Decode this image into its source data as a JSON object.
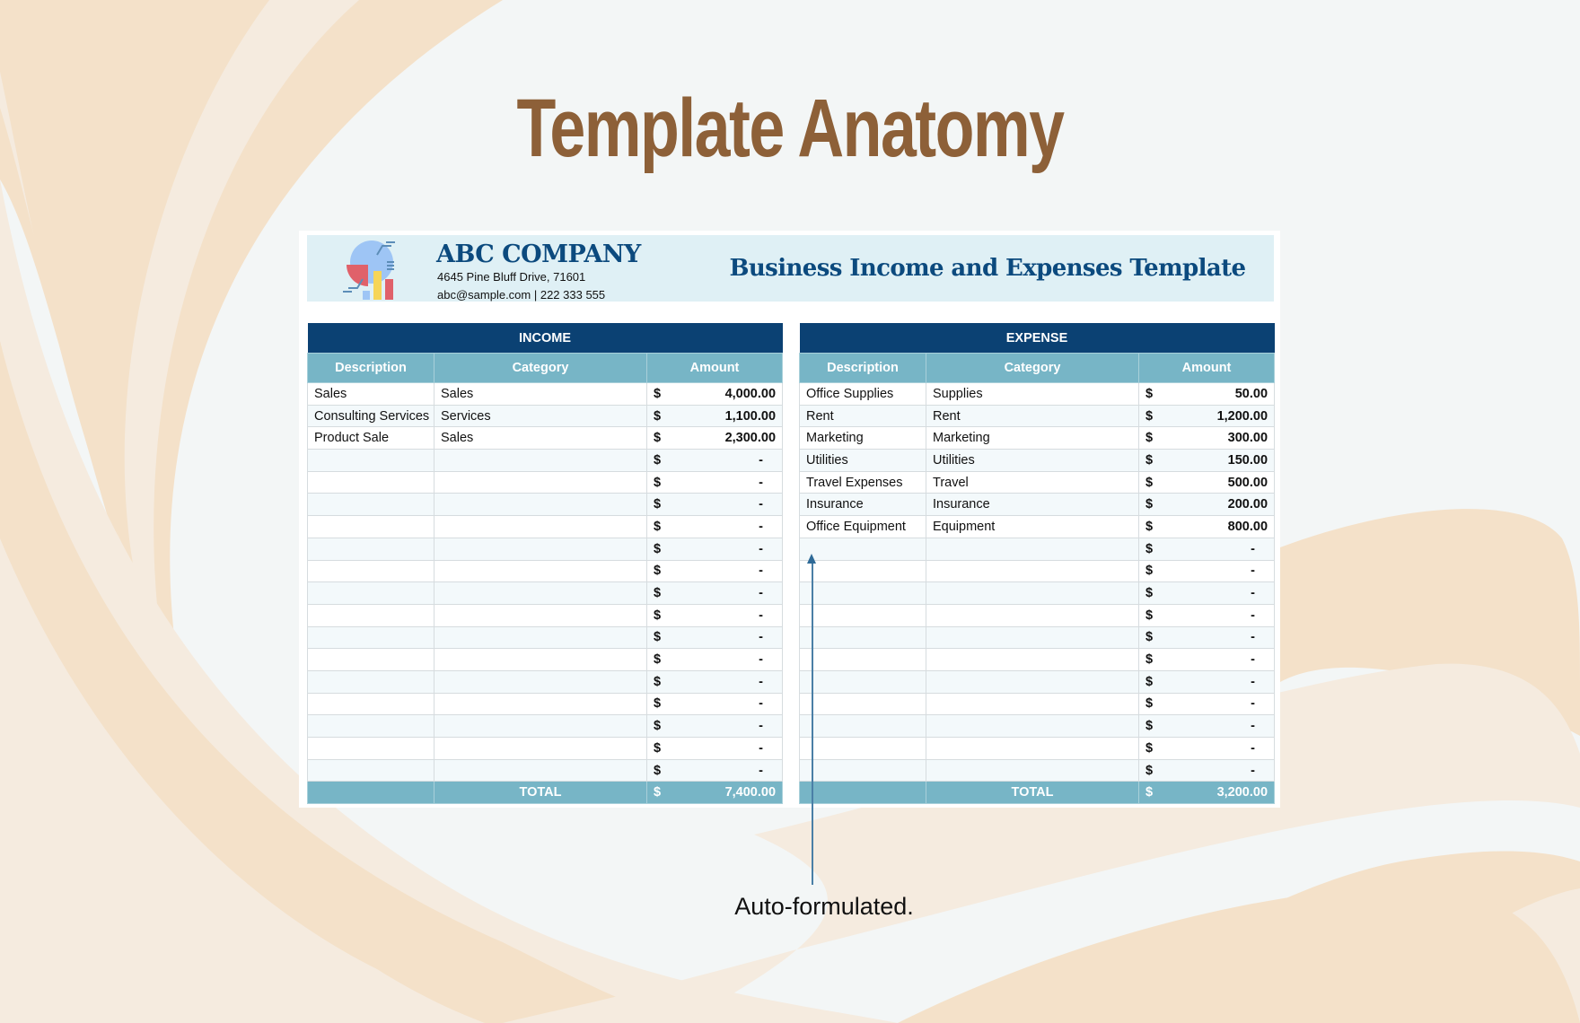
{
  "page_title": "Template Anatomy",
  "header": {
    "company_name": "ABC COMPANY",
    "address": "4645 Pine Bluff Drive, 71601",
    "contact": "abc@sample.com | 222 333 555",
    "document_title": "Business Income and Expenses Template",
    "logo_icon": "chart-report-icon"
  },
  "colors": {
    "title": "#8d6038",
    "section_header": "#0b4173",
    "column_header": "#77b5c6",
    "company_text": "#0c4a7e",
    "band": "#dff0f5",
    "swirl_1": "#f4e1c9",
    "swirl_2": "#f5ebdf"
  },
  "income": {
    "section_label": "INCOME",
    "columns": [
      "Description",
      "Category",
      "Amount"
    ],
    "currency": "$",
    "rows": [
      {
        "description": "Sales",
        "category": "Sales",
        "amount": "4,000.00"
      },
      {
        "description": "Consulting Services",
        "category": "Services",
        "amount": "1,100.00"
      },
      {
        "description": "Product Sale",
        "category": "Sales",
        "amount": "2,300.00"
      },
      {
        "description": "",
        "category": "",
        "amount": "-"
      },
      {
        "description": "",
        "category": "",
        "amount": "-"
      },
      {
        "description": "",
        "category": "",
        "amount": "-"
      },
      {
        "description": "",
        "category": "",
        "amount": "-"
      },
      {
        "description": "",
        "category": "",
        "amount": "-"
      },
      {
        "description": "",
        "category": "",
        "amount": "-"
      },
      {
        "description": "",
        "category": "",
        "amount": "-"
      },
      {
        "description": "",
        "category": "",
        "amount": "-"
      },
      {
        "description": "",
        "category": "",
        "amount": "-"
      },
      {
        "description": "",
        "category": "",
        "amount": "-"
      },
      {
        "description": "",
        "category": "",
        "amount": "-"
      },
      {
        "description": "",
        "category": "",
        "amount": "-"
      },
      {
        "description": "",
        "category": "",
        "amount": "-"
      },
      {
        "description": "",
        "category": "",
        "amount": "-"
      },
      {
        "description": "",
        "category": "",
        "amount": "-"
      }
    ],
    "total_label": "TOTAL",
    "total": "7,400.00"
  },
  "expense": {
    "section_label": "EXPENSE",
    "columns": [
      "Description",
      "Category",
      "Amount"
    ],
    "currency": "$",
    "rows": [
      {
        "description": "Office Supplies",
        "category": "Supplies",
        "amount": "50.00"
      },
      {
        "description": "Rent",
        "category": "Rent",
        "amount": "1,200.00"
      },
      {
        "description": "Marketing",
        "category": "Marketing",
        "amount": "300.00"
      },
      {
        "description": "Utilities",
        "category": "Utilities",
        "amount": "150.00"
      },
      {
        "description": "Travel Expenses",
        "category": "Travel",
        "amount": "500.00"
      },
      {
        "description": "Insurance",
        "category": "Insurance",
        "amount": "200.00"
      },
      {
        "description": "Office Equipment",
        "category": "Equipment",
        "amount": "800.00"
      },
      {
        "description": "",
        "category": "",
        "amount": "-"
      },
      {
        "description": "",
        "category": "",
        "amount": "-"
      },
      {
        "description": "",
        "category": "",
        "amount": "-"
      },
      {
        "description": "",
        "category": "",
        "amount": "-"
      },
      {
        "description": "",
        "category": "",
        "amount": "-"
      },
      {
        "description": "",
        "category": "",
        "amount": "-"
      },
      {
        "description": "",
        "category": "",
        "amount": "-"
      },
      {
        "description": "",
        "category": "",
        "amount": "-"
      },
      {
        "description": "",
        "category": "",
        "amount": "-"
      },
      {
        "description": "",
        "category": "",
        "amount": "-"
      },
      {
        "description": "",
        "category": "",
        "amount": "-"
      }
    ],
    "total_label": "TOTAL",
    "total": "3,200.00"
  },
  "callout": {
    "text": "Auto-formulated."
  }
}
